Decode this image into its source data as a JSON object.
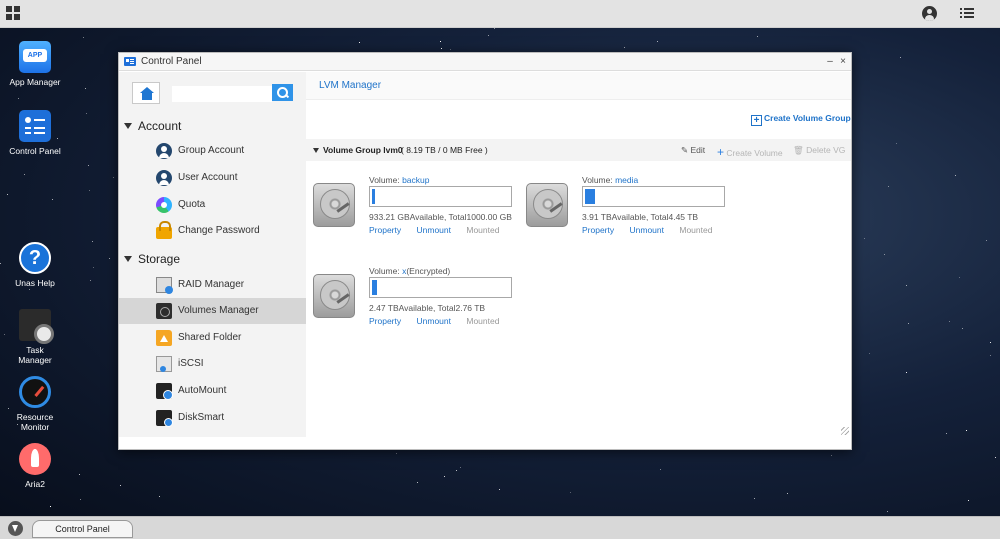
{
  "desktop": {
    "icons": [
      {
        "label": "App Manager",
        "icon": "app-manager-icon",
        "badge": "APP"
      },
      {
        "label": "Control Panel",
        "icon": "control-panel-icon"
      },
      {
        "label": "Unas Help",
        "icon": "help-icon",
        "glyph": "?"
      },
      {
        "label": "Task Manager",
        "icon": "task-manager-icon"
      },
      {
        "label": "Resource Monitor",
        "icon": "resource-monitor-icon"
      },
      {
        "label": "Aria2",
        "icon": "aria2-icon"
      }
    ]
  },
  "window": {
    "title": "Control Panel",
    "minimize_glyph": "–",
    "close_glyph": "×"
  },
  "sidebar": {
    "search_placeholder": "",
    "sections": [
      {
        "label": "Account",
        "items": [
          {
            "label": "Group Account",
            "icon": "group-account-icon"
          },
          {
            "label": "User Account",
            "icon": "user-account-icon"
          },
          {
            "label": "Quota",
            "icon": "quota-icon"
          },
          {
            "label": "Change Password",
            "icon": "lock-icon"
          }
        ]
      },
      {
        "label": "Storage",
        "items": [
          {
            "label": "RAID Manager",
            "icon": "raid-manager-icon"
          },
          {
            "label": "Volumes Manager",
            "icon": "volumes-manager-icon",
            "active": true
          },
          {
            "label": "Shared Folder",
            "icon": "shared-folder-icon"
          },
          {
            "label": "iSCSI",
            "icon": "iscsi-icon"
          },
          {
            "label": "AutoMount",
            "icon": "automount-icon"
          },
          {
            "label": "DiskSmart",
            "icon": "disksmart-icon"
          }
        ]
      }
    ]
  },
  "main": {
    "breadcrumb": "LVM Manager",
    "create_volume_group": "Create Volume Group",
    "volume_group": {
      "name": "Volume Group lvm0",
      "size": "( 8.19 TB / 0 MB Free )",
      "actions": {
        "edit": "Edit",
        "create_volume": "Create Volume",
        "delete_vg": "Delete VG"
      }
    },
    "volume_prefix": "Volume: ",
    "volumes": [
      {
        "name": "backup",
        "suffix": "",
        "info": "933.21 GBAvailable, Total1000.00 GB",
        "usage": 0.01,
        "property": "Property",
        "unmount": "Unmount",
        "status": "Mounted"
      },
      {
        "name": "media",
        "suffix": "",
        "info": "3.91 TBAvailable, Total4.45 TB",
        "usage": 0.07,
        "property": "Property",
        "unmount": "Unmount",
        "status": "Mounted"
      },
      {
        "name": "x",
        "suffix": "(Encrypted)",
        "info": "2.47 TBAvailable, Total2.76 TB",
        "usage": 0.04,
        "property": "Property",
        "unmount": "Unmount",
        "status": "Mounted"
      }
    ]
  },
  "taskbar": {
    "task_label": "Control Panel"
  }
}
